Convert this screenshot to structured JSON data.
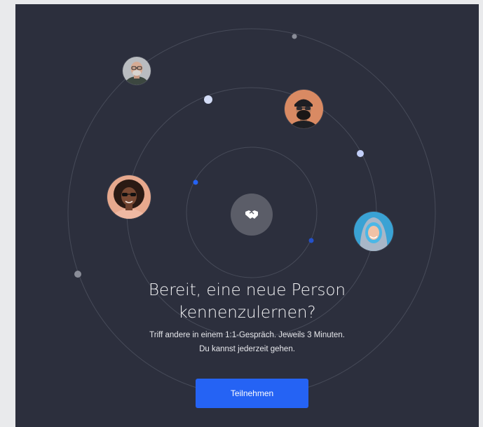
{
  "headline": "Bereit, eine neue Person kennenzulernen?",
  "subtext": "Triff andere in einem 1:1-Gespräch. Jeweils 3 Minuten. Du kannst jederzeit gehen.",
  "join_button_label": "Teilnehmen",
  "center_icon": "handshake-icon",
  "avatars": [
    {
      "name": "avatar-bald-man-glasses",
      "icon": "person-photo"
    },
    {
      "name": "avatar-man-beanie-beard",
      "icon": "person-photo"
    },
    {
      "name": "avatar-woman-curly-hair-sunglasses",
      "icon": "person-photo"
    },
    {
      "name": "avatar-woman-blue-hair-hood",
      "icon": "person-photo"
    }
  ],
  "colors": {
    "background": "#2c2f3d",
    "accent": "#2563f4",
    "orbit_line": "#4a4e5c",
    "dot_light": "#c9d3f3",
    "dot_blue": "#2563f4",
    "dot_gray": "#8a8d98"
  }
}
